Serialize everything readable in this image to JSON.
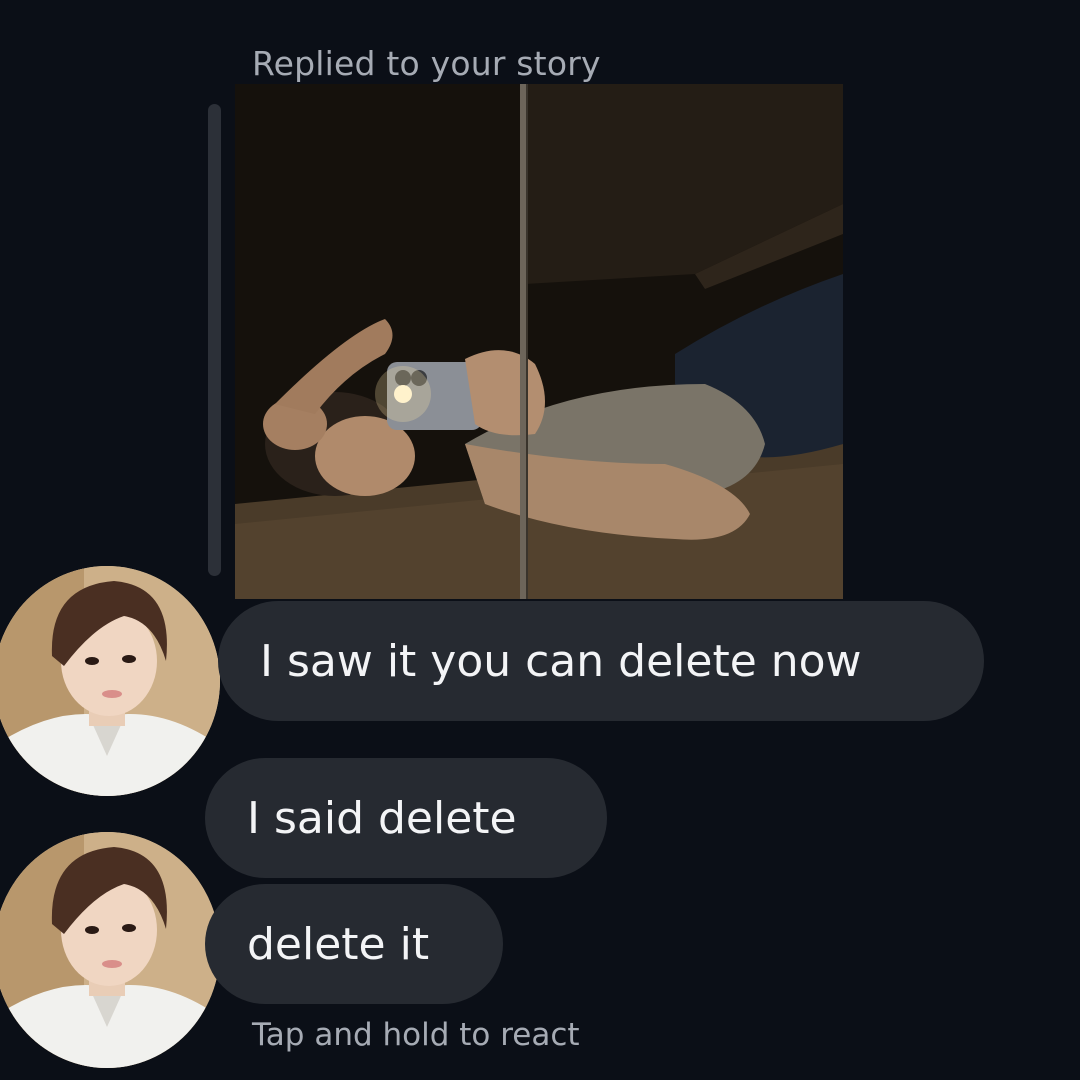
{
  "thread": {
    "reply_caption": "Replied to your story",
    "messages": [
      {
        "text": "I saw it you can delete now"
      },
      {
        "text": "I said delete"
      },
      {
        "text": "delete it"
      }
    ],
    "hint": "Tap and hold to react"
  },
  "colors": {
    "background": "#0b0f17",
    "bubble": "#262a31",
    "secondary_text": "#a6abb4"
  }
}
